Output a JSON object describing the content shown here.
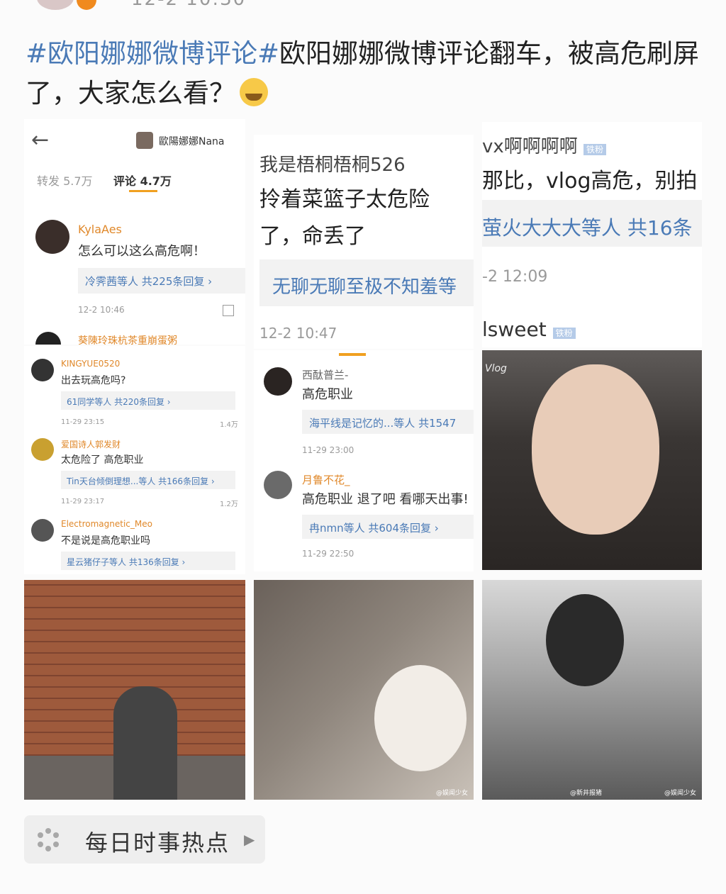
{
  "post": {
    "time": "12-2 10:30",
    "hashtag": "#欧阳娜娜微博评论#",
    "text": "欧阳娜娜微博评论翻车，被高危刷屏了，大家怎么看？"
  },
  "panel1": {
    "username": "歐陽娜娜Nana",
    "tab_repost": "转发 5.7万",
    "tab_comment": "评论 4.7万",
    "comment_user": "KylaAes",
    "comment_text": "怎么可以这么高危啊！",
    "reply_summary": "冷霁茜等人  共225条回复 ›",
    "time": "12-2 10:46",
    "next_user": "葵陳玲珠杭茶重崩蛋粥"
  },
  "panel2": {
    "comments": [
      {
        "user": "KINGYUE0520",
        "text": "出去玩高危吗?",
        "reply": "61同学等人  共220条回复 ›",
        "time": "11-29 23:15",
        "likes": "1.4万"
      },
      {
        "user": "爱国诗人郭发财",
        "text": "太危险了 高危职业",
        "reply": "Tin天台倾倒理想...等人  共166条回复 ›",
        "time": "11-29 23:17",
        "likes": "1.2万"
      },
      {
        "user": "Electromagnetic_Meo",
        "text": "不是说是高危职业吗",
        "reply": "星云猪仔子等人  共136条回复 ›"
      }
    ]
  },
  "panel3": {
    "user": "我是梧桐梧桐526",
    "text": "拎着菜篮子太危险了，命丢了",
    "reply": "无聊无聊至极不知羞等",
    "time": "12-2 10:47"
  },
  "panel4": {
    "comments": [
      {
        "user": "西酞普兰-",
        "text": "高危职业",
        "reply": "海平线是记忆的...等人  共1547",
        "time": "11-29 23:00"
      },
      {
        "user": "月鲁不花_",
        "text": "高危职业 退了吧 看哪天出事!",
        "reply": "冉nmn等人  共604条回复 ›",
        "time": "11-29 22:50"
      }
    ]
  },
  "panel5": {
    "user": "vx啊啊啊啊",
    "user_badge": "铁粉",
    "text": "那比，vlog高危，别拍",
    "reply": "萤火大大大等人  共16条",
    "time": "-2 12:09",
    "next_user": "lsweet",
    "next_badge": "铁粉"
  },
  "photos": {
    "watermark_1": "@娱闻少女",
    "watermark_2": "@新井报猪",
    "watermark_3": "@娱闻少女",
    "vlog_label": "Vlog"
  },
  "topic_chip": {
    "label": "每日时事热点",
    "icon": "topic-icon"
  }
}
